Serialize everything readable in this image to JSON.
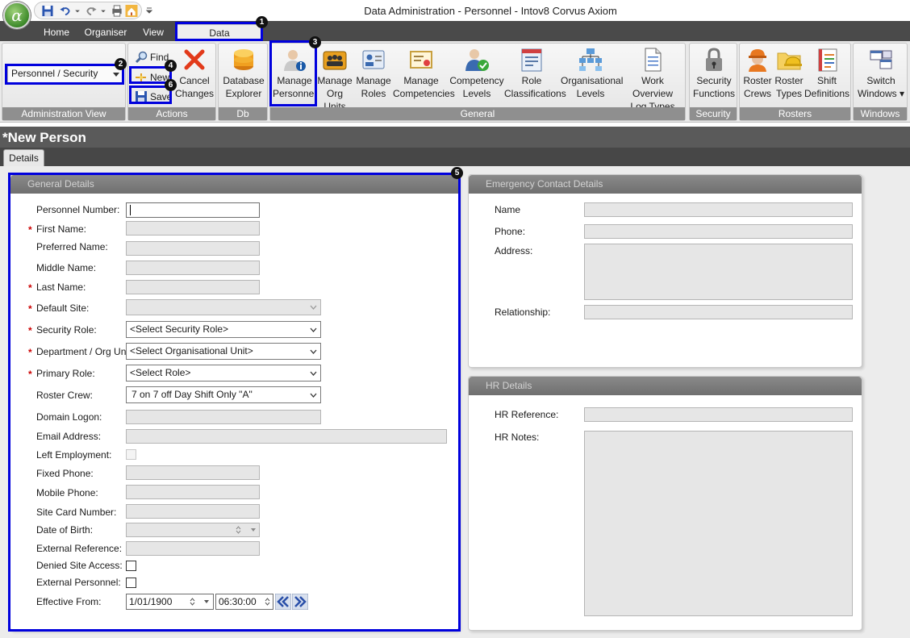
{
  "window": {
    "title": "Data Administration - Personnel - Intov8 Corvus Axiom",
    "orb_glyph": "α"
  },
  "ribbon_tabs": [
    "Home",
    "Organiser",
    "View",
    "Data Administration"
  ],
  "admin_view": {
    "selected": "Personnel / Security",
    "caption": "Administration View"
  },
  "actions": {
    "find": "Find",
    "new": "New",
    "save": "Save",
    "cancel_l1": "Cancel",
    "cancel_l2": "Changes",
    "caption": "Actions"
  },
  "db_explorer": {
    "l1": "Database",
    "l2": "Explorer",
    "caption": "Db Explorer"
  },
  "general": {
    "caption": "General",
    "buttons": [
      {
        "l1": "Manage",
        "l2": "Personnel"
      },
      {
        "l1": "Manage",
        "l2": "Org Units"
      },
      {
        "l1": "Manage",
        "l2": "Roles"
      },
      {
        "l1": "Manage",
        "l2": "Competencies"
      },
      {
        "l1": "Competency",
        "l2": "Levels"
      },
      {
        "l1": "Role",
        "l2": "Classifications"
      },
      {
        "l1": "Organisational",
        "l2": "Levels"
      },
      {
        "l1": "Work Overview",
        "l2": "Log Types"
      }
    ]
  },
  "security": {
    "l1": "Security",
    "l2": "Functions",
    "caption": "Security"
  },
  "rosters": {
    "caption": "Rosters",
    "buttons": [
      {
        "l1": "Roster",
        "l2": "Crews"
      },
      {
        "l1": "Roster",
        "l2": "Types"
      },
      {
        "l1": "Shift",
        "l2": "Definitions"
      }
    ]
  },
  "windows": {
    "l1": "Switch",
    "l2": "Windows",
    "caption": "Windows"
  },
  "badges": [
    "1",
    "2",
    "3",
    "4",
    "5",
    "6"
  ],
  "page": {
    "title": "*New Person",
    "tab": "Details"
  },
  "general_details": {
    "header": "General Details",
    "labels": {
      "personnel_number": "Personnel Number:",
      "first_name": "First Name:",
      "preferred_name": "Preferred Name:",
      "middle_name": "Middle Name:",
      "last_name": "Last Name:",
      "default_site": "Default Site:",
      "security_role": "Security Role:",
      "department": "Department / Org Unit:",
      "primary_role": "Primary Role:",
      "roster_crew": "Roster Crew:",
      "domain_logon": "Domain Logon:",
      "email": "Email Address:",
      "left_employment": "Left Employment:",
      "fixed_phone": "Fixed Phone:",
      "mobile_phone": "Mobile Phone:",
      "site_card": "Site Card Number:",
      "dob": "Date of Birth:",
      "external_ref": "External Reference:",
      "denied_access": "Denied Site Access:",
      "external_personnel": "External Personnel:",
      "effective_from": "Effective From:"
    },
    "required_mark": "*",
    "security_role_value": "<Select Security Role>",
    "department_value": "<Select Organisational Unit>",
    "primary_role_value": "<Select Role>",
    "roster_crew_value": "7 on 7 off Day Shift Only \"A\"",
    "effective_date": "1/01/1900",
    "effective_time": "06:30:00"
  },
  "emergency": {
    "header": "Emergency Contact Details",
    "labels": {
      "name": "Name",
      "phone": "Phone:",
      "address": "Address:",
      "relationship": "Relationship:"
    }
  },
  "hr": {
    "header": "HR Details",
    "labels": {
      "reference": "HR Reference:",
      "notes": "HR Notes:"
    }
  },
  "colors": {
    "highlight": "#0000dd",
    "required": "#cc0000",
    "header_bar": "#5a5a5a"
  }
}
